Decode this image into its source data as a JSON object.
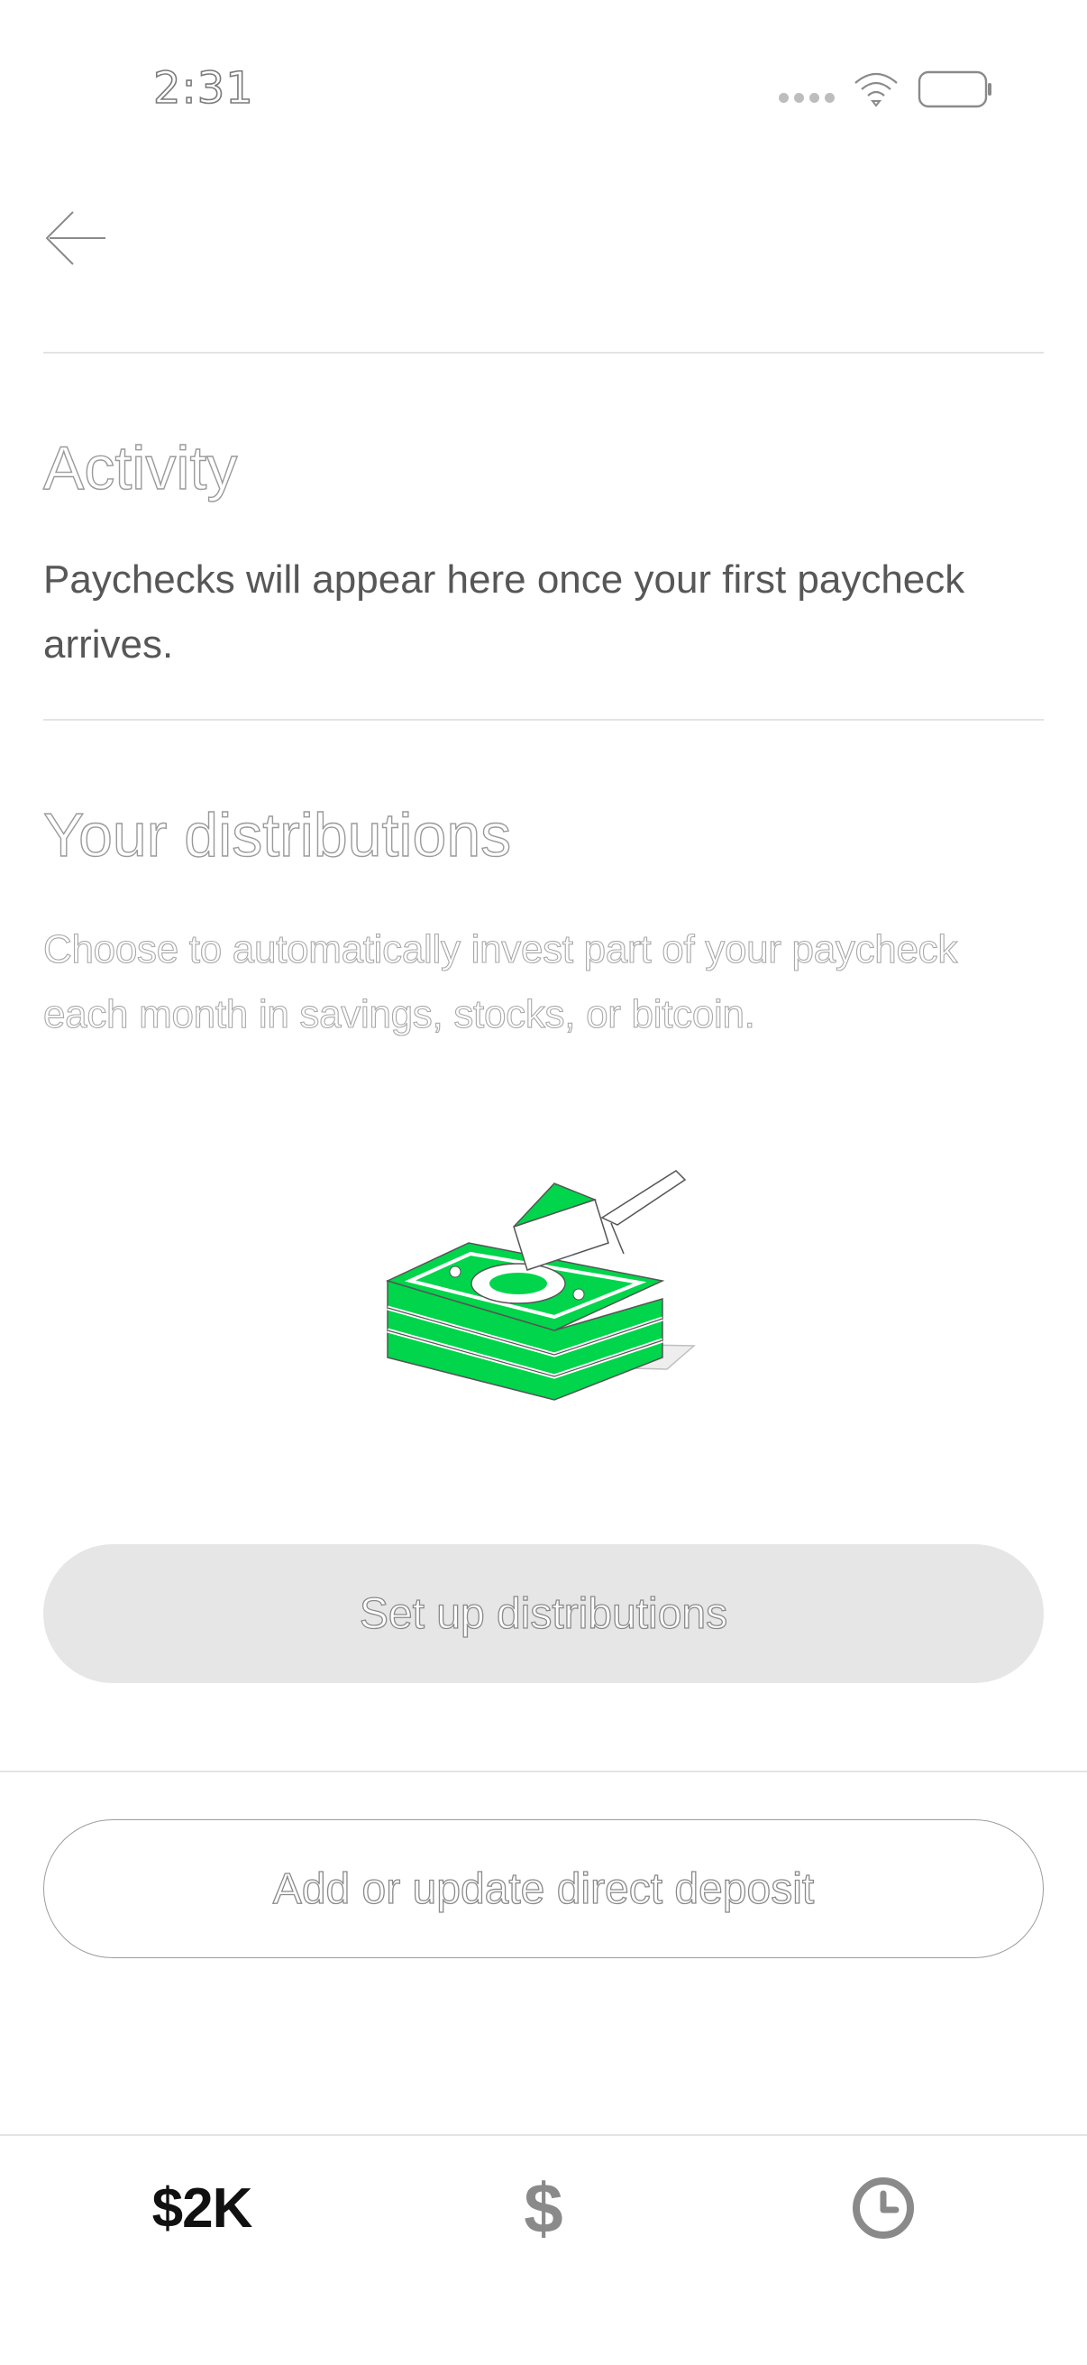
{
  "status_bar": {
    "time": "2:31",
    "wifi_icon": "wifi-icon",
    "battery_icon": "battery-icon"
  },
  "header": {
    "back_icon": "arrow-left-icon"
  },
  "activity": {
    "title": "Activity",
    "description": "Paychecks will appear here once your first paycheck arrives."
  },
  "distributions": {
    "title": "Your distributions",
    "description": "Choose to automatically invest part of your paycheck each month in savings, stocks, or bitcoin.",
    "illustration": "money-stack-pie-slice-illustration",
    "setup_button": "Set up distributions"
  },
  "direct_deposit": {
    "button": "Add or update direct deposit"
  },
  "bottom_nav": {
    "balance_label": "$2K",
    "pay_label": "$",
    "activity_icon": "clock-icon"
  },
  "colors": {
    "accent_green": "#00D54B",
    "button_gray": "#E6E6E6",
    "divider": "#E3E3E3"
  }
}
